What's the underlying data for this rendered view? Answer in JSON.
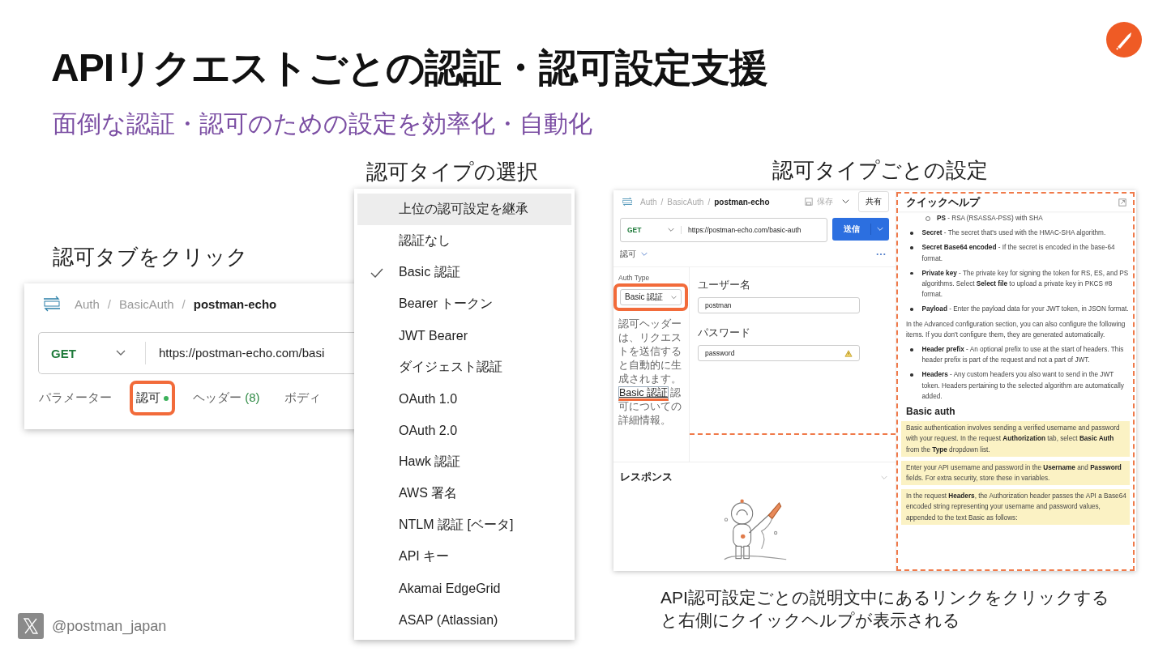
{
  "slide": {
    "title": "APIリクエストごとの認証・認可設定支援",
    "subtitle": "面倒な認証・認可のための設定を効率化・自動化",
    "footer_handle": "@postman_japan"
  },
  "left_shot": {
    "caption": "認可タブをクリック",
    "separator": "/",
    "breadcrumb": [
      "Auth",
      "BasicAuth",
      "postman-echo"
    ],
    "method": "GET",
    "url": "https://postman-echo.com/basi",
    "tabs": [
      {
        "label": "パラメーター",
        "selected": false,
        "dot": false
      },
      {
        "label": "認可",
        "selected": true,
        "dot": true
      },
      {
        "label": "ヘッダー",
        "count": "(8)",
        "selected": false,
        "dot": false
      },
      {
        "label": "ボディ",
        "selected": false,
        "dot": false
      }
    ]
  },
  "menu": {
    "caption": "認可タイプの選択",
    "items": [
      {
        "label": "上位の認可設定を継承",
        "checked": false,
        "hovered": true
      },
      {
        "label": "認証なし",
        "checked": false,
        "hovered": false
      },
      {
        "label": "Basic 認証",
        "checked": true,
        "hovered": false
      },
      {
        "label": "Bearer トークン",
        "checked": false,
        "hovered": false
      },
      {
        "label": "JWT Bearer",
        "checked": false,
        "hovered": false
      },
      {
        "label": "ダイジェスト認証",
        "checked": false,
        "hovered": false
      },
      {
        "label": "OAuth 1.0",
        "checked": false,
        "hovered": false
      },
      {
        "label": "OAuth 2.0",
        "checked": false,
        "hovered": false
      },
      {
        "label": "Hawk 認証",
        "checked": false,
        "hovered": false
      },
      {
        "label": "AWS 署名",
        "checked": false,
        "hovered": false
      },
      {
        "label": "NTLM 認証 [ベータ]",
        "checked": false,
        "hovered": false
      },
      {
        "label": "API キー",
        "checked": false,
        "hovered": false
      },
      {
        "label": "Akamai EdgeGrid",
        "checked": false,
        "hovered": false
      },
      {
        "label": "ASAP (Atlassian)",
        "checked": false,
        "hovered": false
      }
    ]
  },
  "right_shot": {
    "caption": "認可タイプごとの設定",
    "separator": "/",
    "breadcrumb": [
      "Auth",
      "BasicAuth",
      "postman-echo"
    ],
    "save": "保存",
    "share": "共有",
    "method": "GET",
    "url": "https://postman-echo.com/basic-auth",
    "send": "送信",
    "section": "認可",
    "auth_type_label": "Auth Type",
    "auth_type": "Basic 認証",
    "description": "認可ヘッダーは、リクエストを送信すると自動的に生成されます。",
    "description_link": "Basic 認証",
    "description_tail": "認可についての詳細情報。",
    "fields": [
      {
        "label": "ユーザー名",
        "value": "postman",
        "warning": false
      },
      {
        "label": "パスワード",
        "value": "password",
        "warning": true
      }
    ],
    "response": "レスポンス",
    "help": {
      "title": "クイックヘルプ",
      "blocks": [
        {
          "kind": "subbullet",
          "text": "**PS** - RSA (RSASSA-PSS) with SHA"
        },
        {
          "kind": "bullet",
          "text": "**Secret** - The secret that's used with the HMAC-SHA algorithm."
        },
        {
          "kind": "bullet",
          "text": "**Secret Base64 encoded** - If the secret is encoded in the base-64 format."
        },
        {
          "kind": "bullet",
          "text": "**Private key** - The private key for signing the token for RS, ES, and PS algorithms. Select **Select file** to upload a private key in PKCS #8 format."
        },
        {
          "kind": "bullet",
          "text": "**Payload** - Enter the payload data for your JWT token, in JSON format."
        },
        {
          "kind": "para",
          "text": "In the Advanced configuration section, you can also configure the following items. If you don't configure them, they are generated automatically."
        },
        {
          "kind": "bullet",
          "text": "**Header prefix** - An optional prefix to use at the start of headers. This header prefix is part of the request and not a part of JWT."
        },
        {
          "kind": "bullet",
          "text": "**Headers** - Any custom headers you also want to send in the JWT token. Headers pertaining to the selected algorithm are automatically added."
        },
        {
          "kind": "heading",
          "text": "Basic auth"
        },
        {
          "kind": "note",
          "text": "Basic authentication involves sending a verified username and password with your request. In the request **Authorization** tab, select **Basic Auth** from the **Type** dropdown list."
        },
        {
          "kind": "note",
          "text": "Enter your API username and password in the **Username** and **Password** fields. For extra security, store these in variables."
        },
        {
          "kind": "note",
          "text": "In the request **Headers**, the Authorization header passes the API a Base64 encoded string representing your username and password values, appended to the text Basic as follows:"
        }
      ]
    }
  },
  "note": "API認可設定ごとの説明文中にあるリンクをクリックすると右側にクイックヘルプが表示される"
}
